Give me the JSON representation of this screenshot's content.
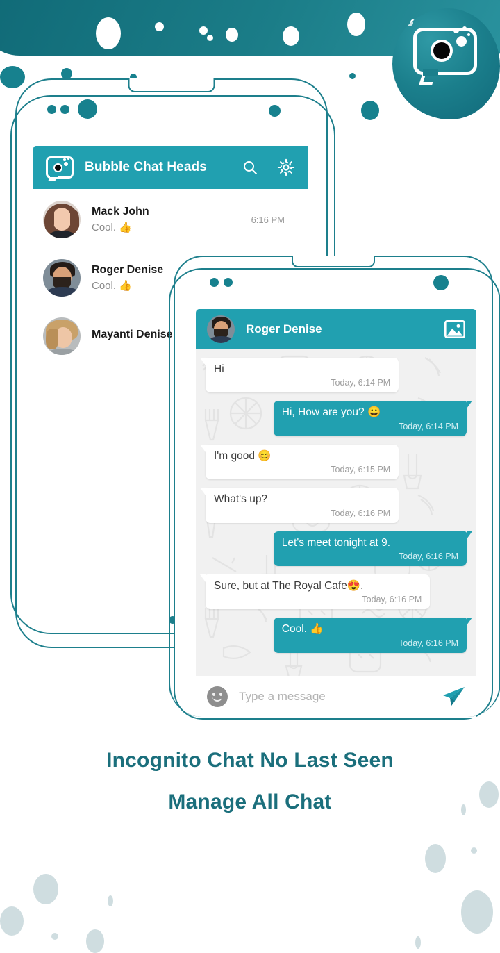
{
  "app": {
    "name": "Bubble Chat Heads",
    "brand_color": "#21a0b0",
    "banner_color": "#136b78",
    "caption_color": "#1b6f7c"
  },
  "banner": {
    "logo_icon": "chat-bubble-camera-logo"
  },
  "phone_list": {
    "header": {
      "title": "Bubble Chat Heads",
      "logo_icon": "app-logo-icon",
      "search_icon": "search-icon",
      "settings_icon": "gear-icon"
    },
    "chats": [
      {
        "name": "Mack John",
        "preview": "Cool. 👍",
        "time": "6:16 PM",
        "avatar": "woman-brown-hair-avatar"
      },
      {
        "name": "Roger Denise",
        "preview": "Cool. 👍",
        "time": "",
        "avatar": "bearded-man-avatar"
      },
      {
        "name": "Mayanti Denise",
        "preview": "",
        "time": "",
        "avatar": "blonde-woman-avatar"
      }
    ]
  },
  "phone_chat": {
    "header": {
      "contact": "Roger Denise",
      "avatar": "bearded-man-avatar",
      "image_icon": "image-gallery-icon"
    },
    "messages": [
      {
        "side": "in",
        "text": "Hi",
        "time": "Today,  6:14 PM"
      },
      {
        "side": "out",
        "text": "Hi,  How are you? 😀",
        "time": "Today,  6:14 PM"
      },
      {
        "side": "in",
        "text": "I'm good 😊",
        "time": "Today,  6:15 PM"
      },
      {
        "side": "in",
        "text": "What's up?",
        "time": "Today,  6:16 PM"
      },
      {
        "side": "out",
        "text": "Let's meet tonight at 9.",
        "time": "Today,  6:16 PM"
      },
      {
        "side": "in",
        "text": "Sure, but at The Royal Cafe😍.",
        "time": "Today,  6:16 PM"
      },
      {
        "side": "out",
        "text": "Cool. 👍",
        "time": "Today,  6:16 PM"
      }
    ],
    "input": {
      "emoji_icon": "emoji-smiley-icon",
      "placeholder": "Type a message",
      "value": "",
      "send_icon": "send-paper-plane-icon"
    }
  },
  "caption": {
    "line1": "Incognito Chat No Last Seen",
    "line2": "Manage All Chat"
  }
}
